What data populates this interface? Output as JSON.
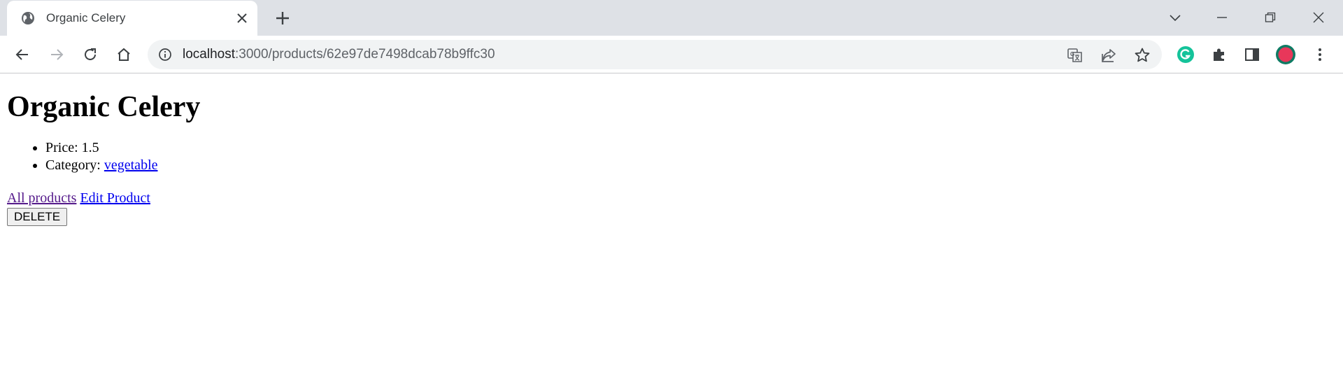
{
  "browser": {
    "tab": {
      "title": "Organic Celery",
      "favicon": "globe-icon"
    },
    "address": {
      "host": "localhost",
      "path": ":3000/products/62e97de7498dcab78b9ffc30"
    },
    "colors": {
      "tabstrip": "#dee1e6",
      "omnibox": "#f1f3f4",
      "grammarly": "#15c39a",
      "profile": "#e8375a"
    }
  },
  "page": {
    "title": "Organic Celery",
    "details": [
      {
        "label": "Price: ",
        "value": "1.5"
      },
      {
        "label": "Category: ",
        "link": "vegetable"
      }
    ],
    "links": {
      "all_products": "All products",
      "edit_product": "Edit Product"
    },
    "delete_label": "DELETE"
  }
}
